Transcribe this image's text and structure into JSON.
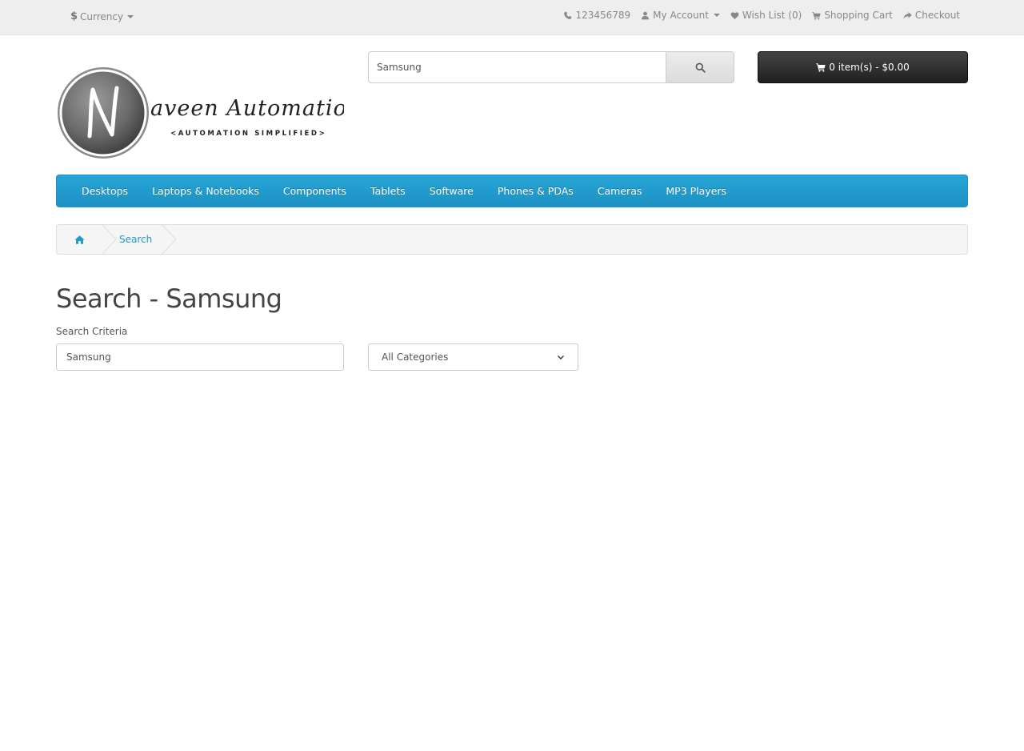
{
  "topbar": {
    "currency_label": "Currency",
    "phone": "123456789",
    "my_account": "My Account",
    "wishlist": "Wish List (0)",
    "shopping_cart": "Shopping Cart",
    "checkout": "Checkout"
  },
  "logo": {
    "main": "aveen Automation Labs",
    "sub": "<AUTOMATION SIMPLIFIED>"
  },
  "header_search": {
    "value": "Samsung"
  },
  "cart": {
    "label": "0 item(s) - $0.00"
  },
  "menu": {
    "items": [
      "Desktops",
      "Laptops & Notebooks",
      "Components",
      "Tablets",
      "Software",
      "Phones & PDAs",
      "Cameras",
      "MP3 Players"
    ]
  },
  "breadcrumb": {
    "items": [
      "Search"
    ]
  },
  "page": {
    "title": "Search - Samsung",
    "criteria_label": "Search Criteria",
    "criteria_value": "Samsung",
    "category_selected": "All Categories"
  },
  "colors": {
    "accent": "#229ac8",
    "menu_bg": "#229ac8",
    "cart_bg": "#303030",
    "topbar_bg": "#eeeeee"
  }
}
